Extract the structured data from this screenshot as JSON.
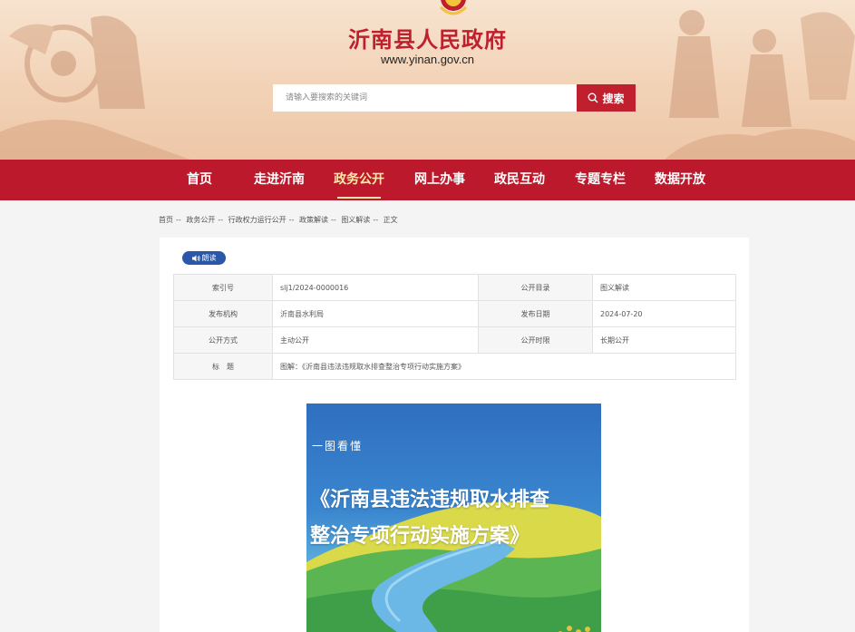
{
  "header": {
    "site_title": "沂南县人民政府",
    "site_url": "www.yinan.gov.cn",
    "search_placeholder": "请输入要搜索的关键词",
    "search_button": "搜索"
  },
  "nav": {
    "items": [
      {
        "label": "首页"
      },
      {
        "label": "走进沂南"
      },
      {
        "label": "政务公开",
        "active": true
      },
      {
        "label": "网上办事"
      },
      {
        "label": "政民互动"
      },
      {
        "label": "专题专栏"
      },
      {
        "label": "数据开放"
      }
    ]
  },
  "breadcrumb": {
    "items": [
      "首页",
      "政务公开",
      "行政权力运行公开",
      "政策解读",
      "图义解读",
      "正文"
    ],
    "separator": "--"
  },
  "article": {
    "read_button": "朗读",
    "meta": {
      "index_label": "索引号",
      "index_value": "slj1/2024-0000016",
      "catalog_label": "公开目录",
      "catalog_value": "图义解读",
      "org_label": "发布机构",
      "org_value": "沂南县水利局",
      "date_label": "发布日期",
      "date_value": "2024-07-20",
      "mode_label": "公开方式",
      "mode_value": "主动公开",
      "period_label": "公开时限",
      "period_value": "长期公开",
      "title_label": "标　题",
      "title_value": "图解：《沂南县违法违规取水排查整治专项行动实施方案》"
    },
    "poster": {
      "subtitle": "一图看懂",
      "title_line1": "《沂南县违法违规取水排查",
      "title_line2": "整治专项行动实施方案》"
    }
  },
  "colors": {
    "brand_red": "#bc1a2c",
    "nav_active": "#ffe9a8",
    "read_blue": "#2a57a8"
  }
}
